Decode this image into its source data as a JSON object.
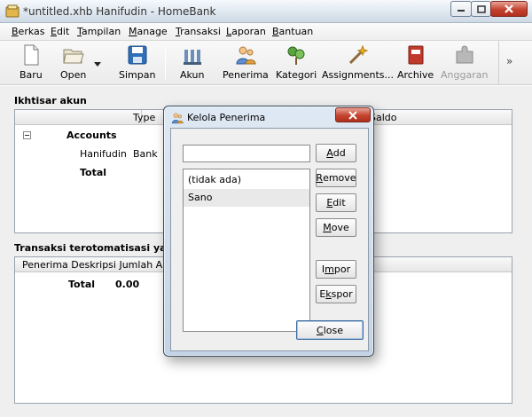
{
  "window": {
    "title": "*untitled.xhb Hanifudin - HomeBank"
  },
  "menu": {
    "berkas": {
      "first": "B",
      "rest": "erkas"
    },
    "edit": {
      "first": "E",
      "rest": "dit"
    },
    "tampilan": {
      "first": "T",
      "rest": "ampilan"
    },
    "manage": {
      "first": "M",
      "rest": "anage"
    },
    "transaksi": {
      "first": "T",
      "rest": "ransaksi"
    },
    "laporan": {
      "first": "L",
      "rest": "aporan"
    },
    "bantuan": {
      "first": "B",
      "rest": "antuan"
    }
  },
  "toolbar": {
    "baru": "Baru",
    "open": "Open",
    "simpan": "Simpan",
    "akun": "Akun",
    "penerima": "Penerima",
    "kategori": "Kategori",
    "assignments": "Assignments...",
    "archive": "Archive",
    "anggaran": "Anggaran",
    "overflow": "»"
  },
  "accounts": {
    "title": "Ikhtisar akun",
    "col_type": "Type",
    "col_saldo": "Saldo",
    "group": "Accounts",
    "row_name": "Hanifudin",
    "row_type": "Bank",
    "total_label": "Total"
  },
  "scheduled": {
    "title": "Transaksi terotomatisasi yang aka",
    "columns": "Penerima Deskripsi Jumlah Akun",
    "total_label": "Total",
    "total_value": "0.00"
  },
  "dialog": {
    "title": "Kelola Penerima",
    "search_value": "",
    "add": {
      "first": "A",
      "rest": "dd"
    },
    "remove": {
      "first": "R",
      "rest": "emove"
    },
    "edit": {
      "first": "E",
      "rest": "dit"
    },
    "move": {
      "first": "M",
      "rest": "ove"
    },
    "import": {
      "a": "I",
      "b": "m",
      "c": "por"
    },
    "export": {
      "a": "E",
      "b": "k",
      "c": "spor"
    },
    "close": {
      "first": "C",
      "rest": "lose"
    },
    "items": [
      "(tidak ada)",
      "Sano"
    ]
  },
  "colors": {
    "accent": "#3d6b9e",
    "close_red": "#c4432f",
    "selection": "#e9e9e9"
  }
}
